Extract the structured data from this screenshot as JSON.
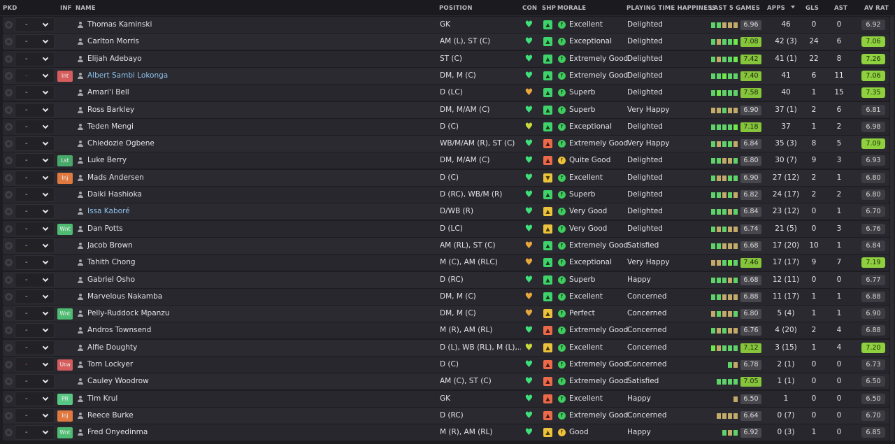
{
  "columns": {
    "pkd": "PKD",
    "inf": "INF",
    "name": "NAME",
    "position": "POSITION",
    "con": "CON",
    "shp": "SHP",
    "morale": "MORALE",
    "playing_time": "PLAYING TIME HAPPINESS",
    "last5": "LAST 5 GAMES",
    "apps": "APPS",
    "gls": "GLS",
    "ast": "AST",
    "avrat": "AV RAT"
  },
  "players": [
    {
      "name": "Thomas Kaminski",
      "link": false,
      "inf": "",
      "inf_type": "",
      "dash_red": false,
      "position": "GK",
      "con": "green",
      "shp": "green",
      "shp_icon": "up-arrow-icon",
      "morale_icon": "green",
      "morale": "Excellent",
      "playing_time": "Delighted",
      "last5_bars": [
        "g",
        "g",
        "o",
        "o",
        "o"
      ],
      "last5_avg": "6.96",
      "last5_hi": false,
      "apps": "46",
      "gls": "0",
      "ast": "0",
      "avrat": "6.92",
      "avrat_hi": false
    },
    {
      "name": "Carlton Morris",
      "link": false,
      "inf": "",
      "inf_type": "",
      "dash_red": false,
      "position": "AM (L), ST (C)",
      "con": "green",
      "shp": "green",
      "shp_icon": "up-arrow-icon",
      "morale_icon": "green",
      "morale": "Exceptional",
      "playing_time": "Delighted",
      "last5_bars": [
        "g",
        "o",
        "g",
        "g",
        "b"
      ],
      "last5_avg": "7.08",
      "last5_hi": true,
      "apps": "42 (3)",
      "gls": "24",
      "ast": "6",
      "avrat": "7.06",
      "avrat_hi": true
    },
    {
      "name": "Elijah Adebayo",
      "link": false,
      "inf": "",
      "inf_type": "",
      "dash_red": false,
      "position": "ST (C)",
      "con": "green",
      "shp": "green",
      "shp_icon": "up-arrow-icon",
      "morale_icon": "green",
      "morale": "Extremely Good",
      "playing_time": "Delighted",
      "last5_bars": [
        "g",
        "o",
        "g",
        "g",
        "b"
      ],
      "last5_avg": "7.42",
      "last5_hi": true,
      "apps": "41 (1)",
      "gls": "22",
      "ast": "8",
      "avrat": "7.26",
      "avrat_hi": true
    },
    {
      "name": "Albert Sambi Lokonga",
      "link": true,
      "inf": "Int",
      "inf_type": "int",
      "dash_red": true,
      "position": "DM, M (C)",
      "con": "green",
      "shp": "green",
      "shp_icon": "up-arrow-icon",
      "morale_icon": "green",
      "morale": "Extremely Good",
      "playing_time": "Delighted",
      "last5_bars": [
        "g",
        "g",
        "b",
        "g",
        "g"
      ],
      "last5_avg": "7.40",
      "last5_hi": true,
      "apps": "41",
      "gls": "6",
      "ast": "11",
      "avrat": "7.06",
      "avrat_hi": true
    },
    {
      "name": "Amari'i Bell",
      "link": false,
      "inf": "",
      "inf_type": "",
      "dash_red": false,
      "position": "D (LC)",
      "con": "gold",
      "shp": "green",
      "shp_icon": "up-arrow-icon",
      "morale_icon": "green",
      "morale": "Superb",
      "playing_time": "Delighted",
      "last5_bars": [
        "g",
        "b",
        "g",
        "g",
        "g"
      ],
      "last5_avg": "7.58",
      "last5_hi": true,
      "apps": "40",
      "gls": "1",
      "ast": "15",
      "avrat": "7.35",
      "avrat_hi": true
    },
    {
      "name": "Ross Barkley",
      "link": false,
      "inf": "",
      "inf_type": "",
      "dash_red": false,
      "position": "DM, M/AM (C)",
      "con": "green",
      "shp": "green",
      "shp_icon": "up-arrow-icon",
      "morale_icon": "green",
      "morale": "Superb",
      "playing_time": "Very Happy",
      "last5_bars": [
        "o",
        "o",
        "g",
        "o",
        "o"
      ],
      "last5_avg": "6.90",
      "last5_hi": false,
      "apps": "37 (1)",
      "gls": "2",
      "ast": "6",
      "avrat": "6.81",
      "avrat_hi": false
    },
    {
      "name": "Teden Mengi",
      "link": false,
      "inf": "",
      "inf_type": "",
      "dash_red": false,
      "position": "D (C)",
      "con": "yellow",
      "shp": "green",
      "shp_icon": "up-arrow-icon",
      "morale_icon": "green",
      "morale": "Exceptional",
      "playing_time": "Delighted",
      "last5_bars": [
        "g",
        "g",
        "g",
        "g",
        "b"
      ],
      "last5_avg": "7.18",
      "last5_hi": true,
      "apps": "37",
      "gls": "1",
      "ast": "2",
      "avrat": "6.98",
      "avrat_hi": false
    },
    {
      "name": "Chiedozie Ogbene",
      "link": false,
      "inf": "",
      "inf_type": "",
      "dash_red": false,
      "position": "WB/M/AM (R), ST (C)",
      "con": "green",
      "shp": "red",
      "shp_icon": "up-arrow-icon",
      "morale_icon": "green",
      "morale": "Extremely Good",
      "playing_time": "Very Happy",
      "last5_bars": [
        "g",
        "o",
        "g",
        "g",
        "o"
      ],
      "last5_avg": "6.84",
      "last5_hi": false,
      "apps": "35 (3)",
      "gls": "8",
      "ast": "5",
      "avrat": "7.09",
      "avrat_hi": true
    },
    {
      "name": "Luke Berry",
      "link": false,
      "inf": "Lst",
      "inf_type": "lst",
      "dash_red": false,
      "position": "DM, M/AM (C)",
      "con": "green",
      "shp": "red",
      "shp_icon": "up-arrow-icon",
      "morale_icon": "yellow",
      "morale": "Quite Good",
      "playing_time": "Delighted",
      "last5_bars": [
        "g",
        "g",
        "o",
        "o",
        "g"
      ],
      "last5_avg": "6.80",
      "last5_hi": false,
      "apps": "30 (7)",
      "gls": "9",
      "ast": "3",
      "avrat": "6.93",
      "avrat_hi": false
    },
    {
      "name": "Mads Andersen",
      "link": false,
      "inf": "Inj",
      "inf_type": "inj",
      "dash_red": false,
      "position": "D (C)",
      "con": "green",
      "shp": "yellow",
      "shp_icon": "down-arrow-icon",
      "morale_icon": "green",
      "morale": "Excellent",
      "playing_time": "Delighted",
      "last5_bars": [
        "g",
        "o",
        "o",
        "g",
        "g"
      ],
      "last5_avg": "6.90",
      "last5_hi": false,
      "apps": "27 (12)",
      "gls": "2",
      "ast": "1",
      "avrat": "6.80",
      "avrat_hi": false
    },
    {
      "name": "Daiki Hashioka",
      "link": false,
      "inf": "",
      "inf_type": "",
      "dash_red": false,
      "position": "D (RC), WB/M (R)",
      "con": "green",
      "shp": "green",
      "shp_icon": "up-arrow-icon",
      "morale_icon": "green",
      "morale": "Superb",
      "playing_time": "Delighted",
      "last5_bars": [
        "g",
        "g",
        "o",
        "g",
        "o"
      ],
      "last5_avg": "6.82",
      "last5_hi": false,
      "apps": "24 (17)",
      "gls": "2",
      "ast": "2",
      "avrat": "6.80",
      "avrat_hi": false
    },
    {
      "name": "Issa Kaboré",
      "link": true,
      "inf": "",
      "inf_type": "",
      "dash_red": false,
      "position": "D/WB (R)",
      "con": "green",
      "shp": "yellow",
      "shp_icon": "up-arrow-icon",
      "morale_icon": "green",
      "morale": "Very Good",
      "playing_time": "Delighted",
      "last5_bars": [
        "g",
        "g",
        "g",
        "o",
        "g"
      ],
      "last5_avg": "6.84",
      "last5_hi": false,
      "apps": "23 (12)",
      "gls": "0",
      "ast": "1",
      "avrat": "6.70",
      "avrat_hi": false
    },
    {
      "name": "Dan Potts",
      "link": false,
      "inf": "Wnt",
      "inf_type": "wnt",
      "dash_red": false,
      "position": "D (LC)",
      "con": "green",
      "shp": "yellow",
      "shp_icon": "up-arrow-icon",
      "morale_icon": "green",
      "morale": "Very Good",
      "playing_time": "Delighted",
      "last5_bars": [
        "g",
        "o",
        "g",
        "o",
        "o"
      ],
      "last5_avg": "6.74",
      "last5_hi": false,
      "apps": "21 (5)",
      "gls": "0",
      "ast": "3",
      "avrat": "6.76",
      "avrat_hi": false
    },
    {
      "name": "Jacob Brown",
      "link": false,
      "inf": "",
      "inf_type": "",
      "dash_red": false,
      "position": "AM (RL), ST (C)",
      "con": "gold",
      "shp": "green",
      "shp_icon": "up-arrow-icon",
      "morale_icon": "green",
      "morale": "Extremely Good",
      "playing_time": "Satisfied",
      "last5_bars": [
        "g",
        "g",
        "o",
        "o",
        "o"
      ],
      "last5_avg": "6.68",
      "last5_hi": false,
      "apps": "17 (20)",
      "gls": "10",
      "ast": "1",
      "avrat": "6.84",
      "avrat_hi": false
    },
    {
      "name": "Tahith Chong",
      "link": false,
      "inf": "",
      "inf_type": "",
      "dash_red": false,
      "position": "M (C), AM (RLC)",
      "con": "gold",
      "shp": "green",
      "shp_icon": "up-arrow-icon",
      "morale_icon": "green",
      "morale": "Exceptional",
      "playing_time": "Very Happy",
      "last5_bars": [
        "o",
        "o",
        "g",
        "b",
        "g"
      ],
      "last5_avg": "7.46",
      "last5_hi": true,
      "apps": "17 (17)",
      "gls": "9",
      "ast": "7",
      "avrat": "7.19",
      "avrat_hi": true
    },
    {
      "name": "Gabriel Osho",
      "link": false,
      "inf": "",
      "inf_type": "",
      "dash_red": false,
      "position": "D (RC)",
      "con": "green",
      "shp": "green",
      "shp_icon": "up-arrow-icon",
      "morale_icon": "green",
      "morale": "Superb",
      "playing_time": "Happy",
      "last5_bars": [
        "g",
        "g",
        "g",
        "o",
        "g"
      ],
      "last5_avg": "6.68",
      "last5_hi": false,
      "apps": "12 (11)",
      "gls": "0",
      "ast": "0",
      "avrat": "6.77",
      "avrat_hi": false
    },
    {
      "name": "Marvelous Nakamba",
      "link": false,
      "inf": "",
      "inf_type": "",
      "dash_red": false,
      "position": "DM, M (C)",
      "con": "gold",
      "shp": "green",
      "shp_icon": "up-arrow-icon",
      "morale_icon": "green",
      "morale": "Excellent",
      "playing_time": "Concerned",
      "last5_bars": [
        "g",
        "g",
        "o",
        "o",
        "o"
      ],
      "last5_avg": "6.88",
      "last5_hi": false,
      "apps": "11 (17)",
      "gls": "1",
      "ast": "1",
      "avrat": "6.88",
      "avrat_hi": false
    },
    {
      "name": "Pelly-Ruddock Mpanzu",
      "link": false,
      "inf": "Wnt",
      "inf_type": "wnt",
      "dash_red": false,
      "position": "DM, M (C)",
      "con": "gold",
      "shp": "yellow",
      "shp_icon": "up-arrow-icon",
      "morale_icon": "green",
      "morale": "Perfect",
      "playing_time": "Concerned",
      "last5_bars": [
        "o",
        "g",
        "o",
        "o",
        "g"
      ],
      "last5_avg": "6.80",
      "last5_hi": false,
      "apps": "5 (4)",
      "gls": "1",
      "ast": "1",
      "avrat": "6.90",
      "avrat_hi": false
    },
    {
      "name": "Andros Townsend",
      "link": false,
      "inf": "",
      "inf_type": "",
      "dash_red": false,
      "position": "M (R), AM (RL)",
      "con": "green",
      "shp": "red",
      "shp_icon": "up-arrow-icon",
      "morale_icon": "green",
      "morale": "Extremely Good",
      "playing_time": "Concerned",
      "last5_bars": [
        "g",
        "o",
        "g",
        "o",
        "o"
      ],
      "last5_avg": "6.76",
      "last5_hi": false,
      "apps": "4 (20)",
      "gls": "2",
      "ast": "4",
      "avrat": "6.88",
      "avrat_hi": false
    },
    {
      "name": "Alfie Doughty",
      "link": false,
      "inf": "",
      "inf_type": "",
      "dash_red": false,
      "position": "D (L), WB (RL), M (L),...",
      "con": "yellow",
      "shp": "yellow",
      "shp_icon": "up-arrow-icon",
      "morale_icon": "green",
      "morale": "Excellent",
      "playing_time": "Concerned",
      "last5_bars": [
        "b",
        "o",
        "g",
        "g",
        "g"
      ],
      "last5_avg": "7.12",
      "last5_hi": true,
      "apps": "3 (15)",
      "gls": "1",
      "ast": "4",
      "avrat": "7.20",
      "avrat_hi": true
    },
    {
      "name": "Tom Lockyer",
      "link": false,
      "inf": "Una",
      "inf_type": "una",
      "dash_red": true,
      "position": "D (C)",
      "con": "green",
      "shp": "red",
      "shp_icon": "up-arrow-icon",
      "morale_icon": "green",
      "morale": "Extremely Good",
      "playing_time": "Concerned",
      "last5_bars": [
        "none",
        "none",
        "none",
        "g",
        "o"
      ],
      "last5_avg": "6.78",
      "last5_hi": false,
      "apps": "2 (1)",
      "gls": "0",
      "ast": "0",
      "avrat": "6.73",
      "avrat_hi": false
    },
    {
      "name": "Cauley Woodrow",
      "link": false,
      "inf": "",
      "inf_type": "",
      "dash_red": false,
      "position": "AM (C), ST (C)",
      "con": "green",
      "shp": "red",
      "shp_icon": "up-arrow-icon",
      "morale_icon": "green",
      "morale": "Extremely Good",
      "playing_time": "Satisfied",
      "last5_bars": [
        "none",
        "g",
        "g",
        "g",
        "g"
      ],
      "last5_avg": "7.05",
      "last5_hi": true,
      "apps": "1 (1)",
      "gls": "0",
      "ast": "0",
      "avrat": "6.50",
      "avrat_hi": false
    },
    {
      "name": "Tim Krul",
      "link": false,
      "inf": "PR",
      "inf_type": "pr",
      "dash_red": false,
      "position": "GK",
      "con": "green",
      "shp": "red",
      "shp_icon": "up-arrow-icon",
      "morale_icon": "green",
      "morale": "Excellent",
      "playing_time": "Happy",
      "last5_bars": [
        "none",
        "none",
        "none",
        "none",
        "o"
      ],
      "last5_avg": "6.50",
      "last5_hi": false,
      "apps": "1",
      "gls": "0",
      "ast": "0",
      "avrat": "6.50",
      "avrat_hi": false
    },
    {
      "name": "Reece Burke",
      "link": false,
      "inf": "Inj",
      "inf_type": "inj",
      "dash_red": false,
      "position": "D (RC)",
      "con": "green",
      "shp": "red",
      "shp_icon": "up-arrow-icon",
      "morale_icon": "green",
      "morale": "Extremely Good",
      "playing_time": "Concerned",
      "last5_bars": [
        "none",
        "o",
        "o",
        "o",
        "o"
      ],
      "last5_avg": "6.64",
      "last5_hi": false,
      "apps": "0 (7)",
      "gls": "0",
      "ast": "0",
      "avrat": "6.70",
      "avrat_hi": false
    },
    {
      "name": "Fred Onyedinma",
      "link": false,
      "inf": "Wnt",
      "inf_type": "wnt",
      "dash_red": false,
      "position": "M (R), AM (RL)",
      "con": "green",
      "shp": "yellow",
      "shp_icon": "up-arrow-icon",
      "morale_icon": "yellow",
      "morale": "Good",
      "playing_time": "Happy",
      "last5_bars": [
        "none",
        "none",
        "g",
        "o",
        "g"
      ],
      "last5_avg": "6.92",
      "last5_hi": false,
      "apps": "0 (3)",
      "gls": "1",
      "ast": "0",
      "avrat": "6.85",
      "avrat_hi": false
    }
  ]
}
